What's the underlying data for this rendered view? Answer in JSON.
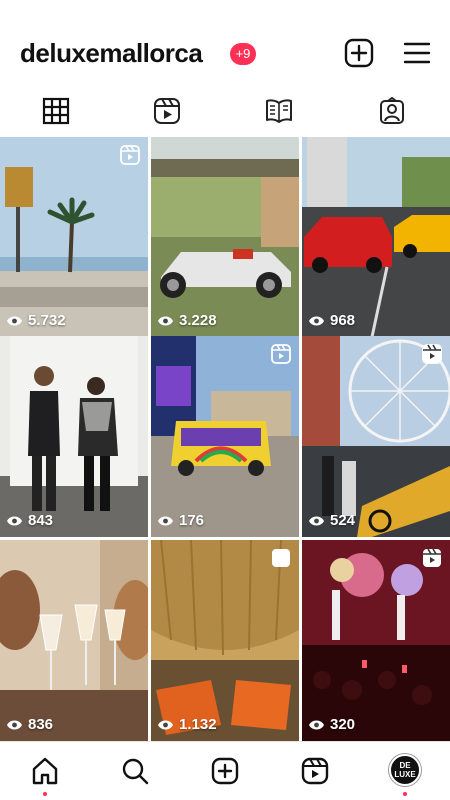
{
  "profile": {
    "username": "deluxemallorca",
    "notification_badge": "+9"
  },
  "header": {
    "create_icon": "plus-square-icon",
    "menu_icon": "hamburger-menu-icon"
  },
  "tabs": [
    {
      "name": "posts-grid",
      "icon": "grid-icon",
      "active": true
    },
    {
      "name": "reels",
      "icon": "reels-icon",
      "active": false
    },
    {
      "name": "guides",
      "icon": "book-icon",
      "active": false
    },
    {
      "name": "tagged",
      "icon": "tagged-person-icon",
      "active": false
    }
  ],
  "grid": [
    {
      "views": "5.732",
      "reel": true,
      "scene": "beach-palm"
    },
    {
      "views": "3.228",
      "reel": false,
      "scene": "vintage-racecar"
    },
    {
      "views": "968",
      "reel": false,
      "scene": "supercars"
    },
    {
      "views": "843",
      "reel": false,
      "scene": "couple-fashion"
    },
    {
      "views": "176",
      "reel": true,
      "scene": "hippie-van"
    },
    {
      "views": "524",
      "reel": true,
      "scene": "ferris-wheel"
    },
    {
      "views": "836",
      "reel": false,
      "scene": "wine-toast"
    },
    {
      "views": "1.132",
      "reel": true,
      "scene": "orange-chairs"
    },
    {
      "views": "320",
      "reel": true,
      "scene": "concert"
    }
  ],
  "bottom_nav": [
    {
      "name": "home",
      "icon": "home-icon",
      "notification_dot": true
    },
    {
      "name": "search",
      "icon": "search-icon",
      "notification_dot": false
    },
    {
      "name": "create",
      "icon": "plus-square-icon",
      "notification_dot": false
    },
    {
      "name": "reels",
      "icon": "reels-icon",
      "notification_dot": false
    },
    {
      "name": "profile",
      "icon": "avatar",
      "notification_dot": true
    }
  ],
  "avatar_text": "DE LUXE",
  "colors": {
    "accent": "#ff2f55",
    "text": "#111111",
    "background": "#ffffff"
  }
}
